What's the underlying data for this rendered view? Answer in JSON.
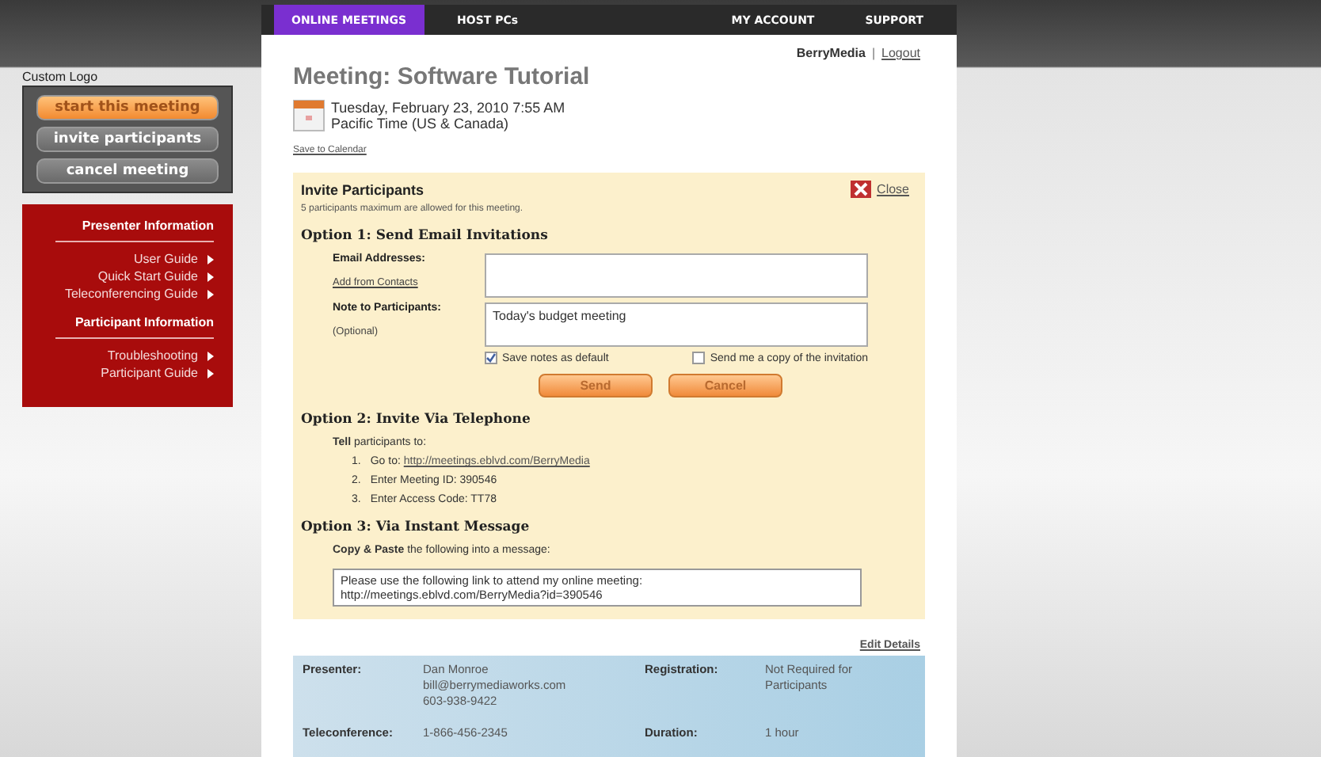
{
  "nav": {
    "tabs": [
      {
        "label": "ONLINE MEETINGS",
        "selected": true
      },
      {
        "label": "HOST PCs",
        "selected": false
      },
      {
        "label": "MY ACCOUNT",
        "selected": false
      },
      {
        "label": "SUPPORT",
        "selected": false
      }
    ]
  },
  "sidebar": {
    "logo_label": "Custom Logo",
    "buttons": [
      {
        "label": "start this meeting",
        "kind": "primary"
      },
      {
        "label": "invite participants",
        "kind": "secondary"
      },
      {
        "label": "cancel meeting",
        "kind": "secondary"
      }
    ],
    "sections": [
      {
        "heading": "Presenter Information",
        "links": [
          "User Guide",
          "Quick Start Guide",
          "Teleconferencing Guide"
        ]
      },
      {
        "heading": "Participant Information",
        "links": [
          "Troubleshooting",
          "Participant Guide"
        ]
      }
    ]
  },
  "account": {
    "user": "BerryMedia",
    "separator": "|",
    "logout": "Logout"
  },
  "meeting": {
    "title": "Meeting: Software Tutorial",
    "date": "Tuesday, February 23, 2010 7:55 AM",
    "timezone": "Pacific Time (US & Canada)",
    "save_link": "Save to Calendar"
  },
  "invite": {
    "title": "Invite Participants",
    "limit_note": "5 participants maximum are allowed for this meeting.",
    "close_label": "Close",
    "option1": {
      "heading": "Option 1: Send Email Invitations",
      "email_label": "Email Addresses:",
      "contacts_link": "Add from Contacts",
      "note_label": "Note to Participants:",
      "note_hint": "(Optional)",
      "note_value": "Today's budget meeting",
      "checkboxes": [
        {
          "label": "Save notes as default",
          "checked": true
        },
        {
          "label": "Send me a copy of the invitation",
          "checked": false
        }
      ],
      "buttons": [
        "Send",
        "Cancel"
      ]
    },
    "option2": {
      "heading": "Option 2: Invite Via Telephone",
      "intro": "**Tell** participants to:",
      "steps": [
        {
          "number": "1.",
          "text": "Go to:",
          "link": "http://meetings.eblvd.com/BerryMedia"
        },
        {
          "number": "2.",
          "text": "Enter Meeting ID: 390546"
        },
        {
          "number": "3.",
          "text": "Enter Access Code: TT78"
        }
      ]
    },
    "option3": {
      "heading": "Option 3: Via Instant Message",
      "intro": "**Copy & Paste** the following into a message:",
      "message_lines": [
        "Please use the following link to attend my online meeting:",
        "http://meetings.eblvd.com/BerryMedia?id=390546"
      ]
    }
  },
  "edit_details": "Edit Details",
  "details": {
    "rows": [
      {
        "label": "Presenter:",
        "value": [
          "Dan Monroe",
          "bill@berrymediaworks.com",
          "603-938-9422"
        ],
        "label_2": "Registration:",
        "value_2": [
          "Not Required for",
          "Participants"
        ]
      },
      {
        "label": "Teleconference:",
        "value": [
          "1-866-456-2345"
        ],
        "label_2": "Duration:",
        "value_2": [
          "1 hour"
        ]
      }
    ]
  }
}
